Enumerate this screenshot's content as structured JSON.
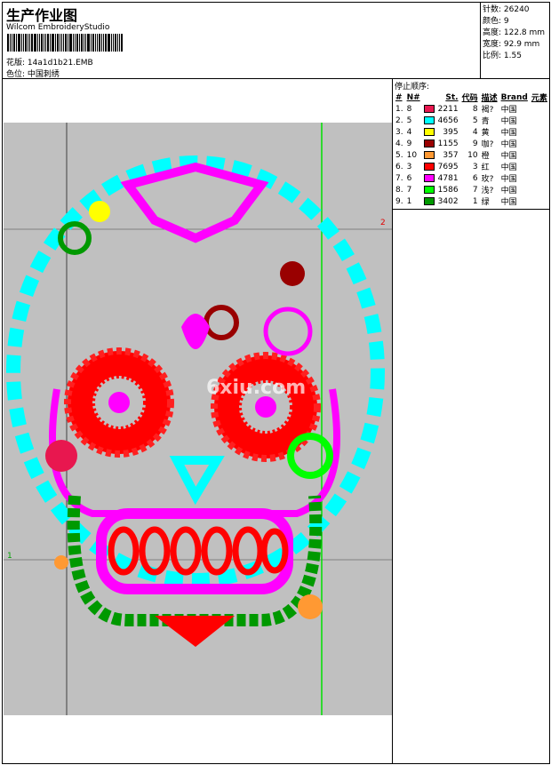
{
  "header": {
    "title": "生产作业图",
    "software": "Wilcom EmbroideryStudio",
    "design_label": "花版:",
    "design_file": "14a1d1b21.EMB",
    "color_label": "色位:",
    "color_value": "中国刺绣"
  },
  "info": {
    "stitches": "针数: 26240",
    "colors": "颜色: 9",
    "height": "高度: 122.8 mm",
    "width": "宽度: 92.9 mm",
    "scale": "比例: 1.55"
  },
  "stop_sequence": {
    "label": "停止顺序:",
    "columns": [
      "#",
      "N#",
      "St.",
      "代码",
      "描述",
      "Brand",
      "元素"
    ],
    "rows": [
      {
        "idx": "1.",
        "n": "8",
        "color": "#e8174f",
        "st": "2211",
        "code": "8",
        "desc": "褐?",
        "brand": "中国"
      },
      {
        "idx": "2.",
        "n": "5",
        "color": "#00ffff",
        "st": "4656",
        "code": "5",
        "desc": "青",
        "brand": "中国"
      },
      {
        "idx": "3.",
        "n": "4",
        "color": "#ffff00",
        "st": "395",
        "code": "4",
        "desc": "黄",
        "brand": "中国"
      },
      {
        "idx": "4.",
        "n": "9",
        "color": "#990000",
        "st": "1155",
        "code": "9",
        "desc": "咖?",
        "brand": "中国"
      },
      {
        "idx": "5.",
        "n": "10",
        "color": "#ff9933",
        "st": "357",
        "code": "10",
        "desc": "橙",
        "brand": "中国"
      },
      {
        "idx": "6.",
        "n": "3",
        "color": "#ff0000",
        "st": "7695",
        "code": "3",
        "desc": "红",
        "brand": "中国"
      },
      {
        "idx": "7.",
        "n": "6",
        "color": "#ff00ff",
        "st": "4781",
        "code": "6",
        "desc": "玫?",
        "brand": "中国"
      },
      {
        "idx": "8.",
        "n": "7",
        "color": "#00ff00",
        "st": "1586",
        "code": "7",
        "desc": "浅?",
        "brand": "中国"
      },
      {
        "idx": "9.",
        "n": "1",
        "color": "#009900",
        "st": "3402",
        "code": "1",
        "desc": "绿",
        "brand": "中国"
      }
    ]
  },
  "canvas": {
    "marker_2": "2",
    "marker_1": "1",
    "watermark": "6xiu.com"
  }
}
